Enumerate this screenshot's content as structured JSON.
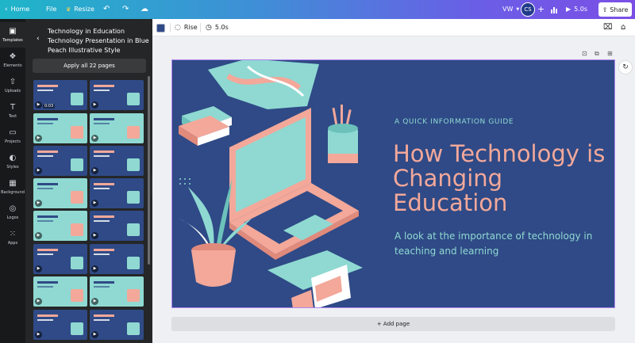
{
  "topbar": {
    "home": "Home",
    "file": "File",
    "resize": "Resize",
    "vw_label": "VW",
    "avatar_initials": "CS",
    "play_duration": "5.0s",
    "share": "Share"
  },
  "rail": {
    "items": [
      {
        "label": "Templates",
        "icon": "templates-icon"
      },
      {
        "label": "Elements",
        "icon": "elements-icon"
      },
      {
        "label": "Uploads",
        "icon": "upload-icon"
      },
      {
        "label": "Text",
        "icon": "text-icon"
      },
      {
        "label": "Projects",
        "icon": "folder-icon"
      },
      {
        "label": "Styles",
        "icon": "palette-icon"
      },
      {
        "label": "Background",
        "icon": "background-icon"
      },
      {
        "label": "Logos",
        "icon": "logo-icon"
      },
      {
        "label": "Apps",
        "icon": "apps-icon"
      }
    ]
  },
  "panel": {
    "title": "Technology in Education Technology Presentation in Blue Peach Illustrative Style",
    "apply_all": "Apply all 22 pages",
    "first_thumb_duration": "0:03"
  },
  "editor_toolbar": {
    "color": "#2f4a86",
    "animation": "Rise",
    "duration": "5.0s"
  },
  "slide": {
    "kicker": "A QUICK INFORMATION GUIDE",
    "title": "How Technology is Changing Education",
    "subtitle": "A look at the importance of technology in teaching and learning"
  },
  "canvas": {
    "add_page": "+ Add page"
  },
  "colors": {
    "navy": "#2f4a86",
    "peach": "#f3a89a",
    "teal": "#8fd9d2",
    "selection": "#b184f0"
  }
}
